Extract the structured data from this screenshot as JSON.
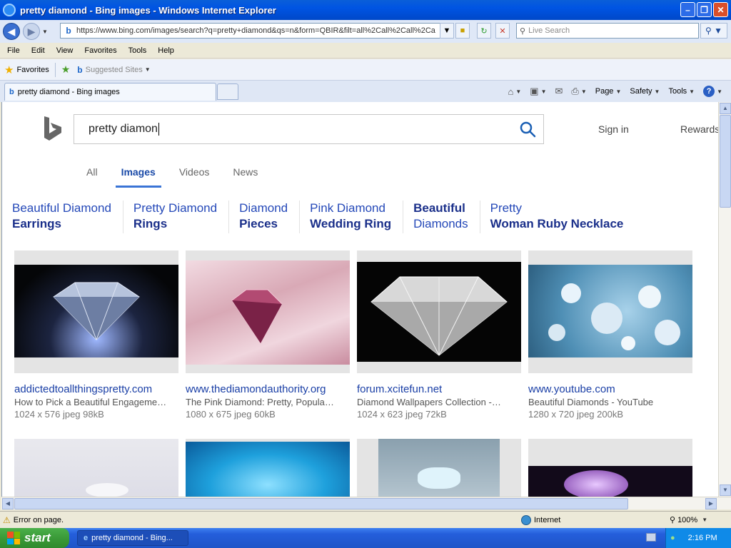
{
  "window": {
    "title": "pretty diamond - Bing images - Windows Internet Explorer",
    "min_icon": "minimize-icon",
    "max_icon": "restore-icon",
    "close_icon": "close-icon"
  },
  "address": {
    "url": "https://www.bing.com/images/search?q=pretty+diamond&qs=n&form=QBIR&filt=all%2Call%2Call%2Ca",
    "search_placeholder": "Live Search"
  },
  "menu": [
    "File",
    "Edit",
    "View",
    "Favorites",
    "Tools",
    "Help"
  ],
  "favorites_bar": {
    "favorites_label": "Favorites",
    "suggested_label": "Suggested Sites"
  },
  "tab": {
    "label": "pretty diamond - Bing images"
  },
  "command_bar": {
    "page": "Page",
    "safety": "Safety",
    "tools": "Tools"
  },
  "bing": {
    "query": "pretty diamon",
    "sign_in": "Sign in",
    "rewards": "Rewards",
    "scopes": [
      {
        "label": "All",
        "active": false
      },
      {
        "label": "Images",
        "active": true
      },
      {
        "label": "Videos",
        "active": false
      },
      {
        "label": "News",
        "active": false
      }
    ],
    "related": [
      {
        "line1": "Beautiful Diamond",
        "line2": "Earrings"
      },
      {
        "line1": "Pretty Diamond",
        "line2": "Rings"
      },
      {
        "line1": "Diamond",
        "line2": "Pieces"
      },
      {
        "line1": "Pink Diamond",
        "line2": "Wedding Ring"
      },
      {
        "line1": "Beautiful",
        "line2": "Diamonds"
      },
      {
        "line1": "Pretty",
        "line2": "Woman Ruby Necklace"
      }
    ],
    "results": [
      {
        "host": "addictedtoallthingspretty.com",
        "desc": "How to Pick a Beautiful Engageme…",
        "meta": "1024 x 576 jpeg 98kB"
      },
      {
        "host": "www.thediamondauthority.org",
        "desc": "The Pink Diamond: Pretty, Popula…",
        "meta": "1080 x 675 jpeg 60kB"
      },
      {
        "host": "forum.xcitefun.net",
        "desc": "Diamond Wallpapers Collection -…",
        "meta": "1024 x 623 jpeg 72kB"
      },
      {
        "host": "www.youtube.com",
        "desc": "Beautiful Diamonds - YouTube",
        "meta": "1280 x 720 jpeg 200kB"
      }
    ]
  },
  "status": {
    "message": "Error on page.",
    "zone": "Internet",
    "zoom": "100%"
  },
  "taskbar": {
    "start": "start",
    "task_item": "pretty diamond - Bing...",
    "clock": "2:16 PM"
  }
}
